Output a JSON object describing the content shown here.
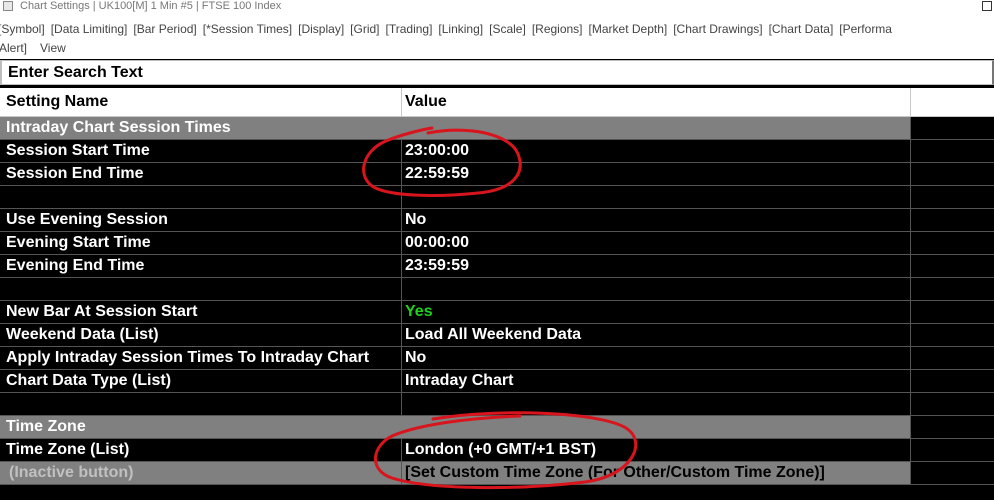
{
  "window": {
    "title": "Chart Settings | UK100[M]  1 Min  #5 | FTSE 100 Index"
  },
  "tabs": {
    "row1": [
      "[Symbol]",
      "[Data Limiting]",
      "[Bar Period]",
      "[*Session Times]",
      "[Display]",
      "[Grid]",
      "[Trading]",
      "[Linking]",
      "[Scale]",
      "[Regions]",
      "[Market Depth]",
      "[Chart Drawings]",
      "[Chart Data]",
      "[Performa"
    ],
    "row2": [
      "Alert]",
      "View"
    ]
  },
  "search": {
    "placeholder": "Enter Search Text"
  },
  "table": {
    "header": {
      "name": "Setting Name",
      "value": "Value"
    },
    "rows": [
      {
        "name": "Intraday Chart Session Times",
        "value": ""
      },
      {
        "name": "Session Start Time",
        "value": "23:00:00"
      },
      {
        "name": "Session End Time",
        "value": "22:59:59"
      },
      {
        "name": "",
        "value": ""
      },
      {
        "name": "Use Evening Session",
        "value": "No"
      },
      {
        "name": "Evening Start Time",
        "value": "00:00:00"
      },
      {
        "name": "Evening End Time",
        "value": "23:59:59"
      },
      {
        "name": "",
        "value": ""
      },
      {
        "name": "New Bar At Session Start",
        "value": "Yes"
      },
      {
        "name": "Weekend Data (List)",
        "value": "Load All Weekend Data"
      },
      {
        "name": "Apply Intraday Session Times To Intraday Chart",
        "value": "No"
      },
      {
        "name": "Chart Data Type (List)",
        "value": "Intraday Chart"
      },
      {
        "name": "",
        "value": ""
      },
      {
        "name": "Time Zone",
        "value": ""
      },
      {
        "name": "Time Zone (List)",
        "value": "London (+0 GMT/+1 BST)"
      },
      {
        "name": "(Inactive button)",
        "value": "[Set Custom Time Zone (For Other/Custom Time Zone)]"
      }
    ]
  },
  "colors": {
    "section_bg": "#808080",
    "grid_bg": "#000000",
    "yes_green": "#1ed21e",
    "annotation_red": "#d8141c"
  }
}
